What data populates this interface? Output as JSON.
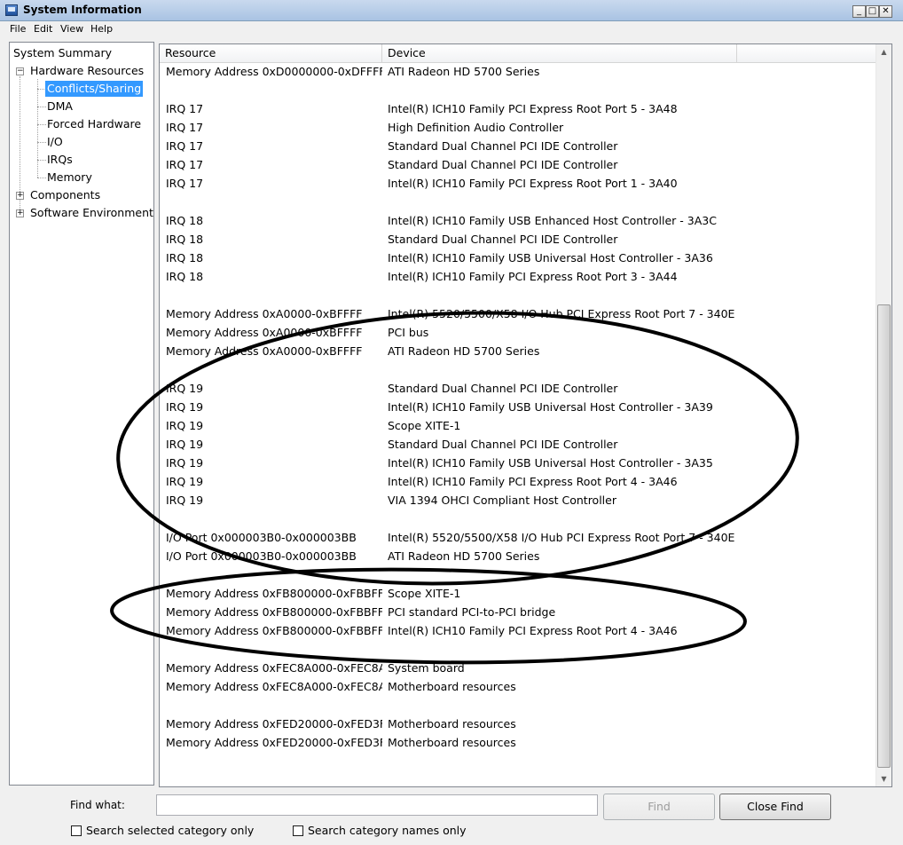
{
  "window": {
    "title": "System Information"
  },
  "menu": [
    "File",
    "Edit",
    "View",
    "Help"
  ],
  "tree": {
    "root": "System Summary",
    "hardware": "Hardware Resources",
    "children": [
      "Conflicts/Sharing",
      "DMA",
      "Forced Hardware",
      "I/O",
      "IRQs",
      "Memory"
    ],
    "components": "Components",
    "software": "Software Environment"
  },
  "columns": {
    "resource": "Resource",
    "device": "Device"
  },
  "rows": [
    {
      "resource": "Memory Address 0xD0000000-0xDFFFFF...",
      "device": "ATI Radeon HD 5700 Series"
    },
    {
      "resource": "",
      "device": ""
    },
    {
      "resource": "IRQ 17",
      "device": "Intel(R) ICH10 Family PCI Express Root Port 5 - 3A48"
    },
    {
      "resource": "IRQ 17",
      "device": "High Definition Audio Controller"
    },
    {
      "resource": "IRQ 17",
      "device": "Standard Dual Channel PCI IDE Controller"
    },
    {
      "resource": "IRQ 17",
      "device": "Standard Dual Channel PCI IDE Controller"
    },
    {
      "resource": "IRQ 17",
      "device": "Intel(R) ICH10 Family PCI Express Root Port 1 - 3A40"
    },
    {
      "resource": "",
      "device": ""
    },
    {
      "resource": "IRQ 18",
      "device": "Intel(R) ICH10 Family USB Enhanced Host Controller - 3A3C"
    },
    {
      "resource": "IRQ 18",
      "device": "Standard Dual Channel PCI IDE Controller"
    },
    {
      "resource": "IRQ 18",
      "device": "Intel(R) ICH10 Family USB Universal Host Controller - 3A36"
    },
    {
      "resource": "IRQ 18",
      "device": "Intel(R) ICH10 Family PCI Express Root Port 3 - 3A44"
    },
    {
      "resource": "",
      "device": ""
    },
    {
      "resource": "Memory Address 0xA0000-0xBFFFF",
      "device": "Intel(R) 5520/5500/X58 I/O Hub PCI Express Root Port 7 - 340E"
    },
    {
      "resource": "Memory Address 0xA0000-0xBFFFF",
      "device": "PCI bus"
    },
    {
      "resource": "Memory Address 0xA0000-0xBFFFF",
      "device": "ATI Radeon HD 5700 Series"
    },
    {
      "resource": "",
      "device": ""
    },
    {
      "resource": "IRQ 19",
      "device": "Standard Dual Channel PCI IDE Controller"
    },
    {
      "resource": "IRQ 19",
      "device": "Intel(R) ICH10 Family USB Universal Host Controller - 3A39"
    },
    {
      "resource": "IRQ 19",
      "device": "Scope XITE-1"
    },
    {
      "resource": "IRQ 19",
      "device": "Standard Dual Channel PCI IDE Controller"
    },
    {
      "resource": "IRQ 19",
      "device": "Intel(R) ICH10 Family USB Universal Host Controller - 3A35"
    },
    {
      "resource": "IRQ 19",
      "device": "Intel(R) ICH10 Family PCI Express Root Port 4 - 3A46"
    },
    {
      "resource": "IRQ 19",
      "device": "VIA 1394 OHCI Compliant Host Controller"
    },
    {
      "resource": "",
      "device": ""
    },
    {
      "resource": "I/O Port 0x000003B0-0x000003BB",
      "device": "Intel(R) 5520/5500/X58 I/O Hub PCI Express Root Port 7 - 340E"
    },
    {
      "resource": "I/O Port 0x000003B0-0x000003BB",
      "device": "ATI Radeon HD 5700 Series"
    },
    {
      "resource": "",
      "device": ""
    },
    {
      "resource": "Memory Address 0xFB800000-0xFBBFFFFF",
      "device": "Scope XITE-1"
    },
    {
      "resource": "Memory Address 0xFB800000-0xFBBFFFFF",
      "device": "PCI standard PCI-to-PCI bridge"
    },
    {
      "resource": "Memory Address 0xFB800000-0xFBBFFFFF",
      "device": "Intel(R) ICH10 Family PCI Express Root Port 4 - 3A46"
    },
    {
      "resource": "",
      "device": ""
    },
    {
      "resource": "Memory Address 0xFEC8A000-0xFEC8A...",
      "device": "System board"
    },
    {
      "resource": "Memory Address 0xFEC8A000-0xFEC8A...",
      "device": "Motherboard resources"
    },
    {
      "resource": "",
      "device": ""
    },
    {
      "resource": "Memory Address 0xFED20000-0xFED3F...",
      "device": "Motherboard resources"
    },
    {
      "resource": "Memory Address 0xFED20000-0xFED3F...",
      "device": "Motherboard resources"
    }
  ],
  "find": {
    "label": "Find what:",
    "value": "",
    "find_button": "Find",
    "close_button": "Close Find",
    "option_selected_category": "Search selected category only",
    "option_category_names": "Search category names only"
  }
}
